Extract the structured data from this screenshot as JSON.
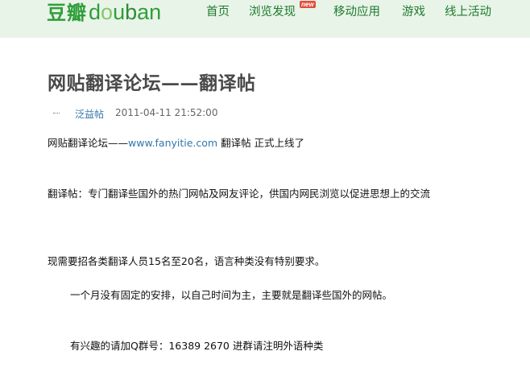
{
  "header": {
    "logo_cn": "豆瓣",
    "logo_en": [
      "d",
      "o",
      "u",
      "b",
      "a",
      "n"
    ],
    "nav": [
      {
        "label": "首页"
      },
      {
        "label": "浏览发现",
        "badge": "new"
      },
      {
        "label": "移动应用"
      },
      {
        "label": "游戏"
      },
      {
        "label": "线上活动"
      }
    ]
  },
  "article": {
    "title": "网贴翻译论坛——翻译帖",
    "author": "泛益帖",
    "time": "2011-04-11 21:52:00",
    "p1_prefix": "网贴翻译论坛——",
    "p1_link": "www.fanyitie.com",
    "p1_suffix": " 翻译帖 正式上线了",
    "p2": "翻译帖：专门翻译些国外的热门网帖及网友评论，供国内网民浏览以促进思想上的交流",
    "p3": "现需要招各类翻译人员15名至20名，语言种类没有特别要求。",
    "p4": "一个月没有固定的安排，以自己时间为主，主要就是翻译些国外的网帖。",
    "p5": "有兴趣的请加Q群号：16389 2670 进群请注明外语种类"
  },
  "colors": {
    "topbar_bg": "#e9f4e9",
    "brand_green": "#2f9e3a",
    "nav_green": "#1e7a2e",
    "link_blue": "#3377aa",
    "new_badge": "#e24c3b"
  }
}
